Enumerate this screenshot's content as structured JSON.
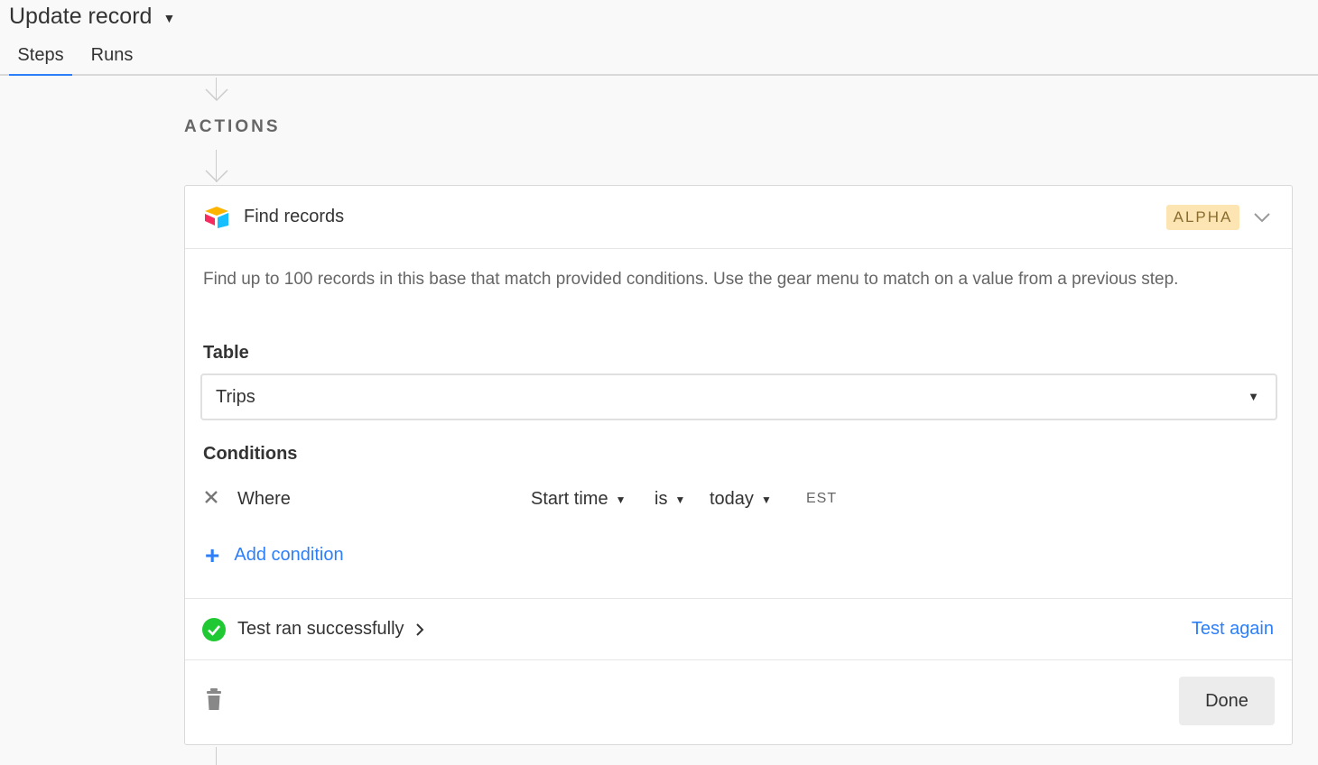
{
  "header": {
    "title": "Update record"
  },
  "tabs": [
    {
      "label": "Steps",
      "active": true
    },
    {
      "label": "Runs",
      "active": false
    }
  ],
  "section": {
    "label": "ACTIONS"
  },
  "action_card": {
    "title": "Find records",
    "badge": "ALPHA",
    "description": "Find up to 100 records in this base that match provided conditions. Use the gear menu to match on a value from a previous step.",
    "table_label": "Table",
    "table_value": "Trips",
    "conditions_label": "Conditions",
    "condition": {
      "where": "Where",
      "field": "Start time",
      "operator": "is",
      "value": "today",
      "timezone": "EST"
    },
    "add_condition": "Add condition",
    "test_status": "Test ran successfully",
    "test_again": "Test again",
    "done": "Done"
  },
  "colors": {
    "accent": "#2d7ff9",
    "success": "#20c933",
    "badge_bg": "#fde5b3"
  },
  "icons": [
    "dropdown-caret-icon",
    "chevron-down-icon",
    "airtable-logo-icon",
    "close-icon",
    "plus-icon",
    "check-circle-icon",
    "chevron-right-icon",
    "trash-icon",
    "arrow-down-icon"
  ]
}
